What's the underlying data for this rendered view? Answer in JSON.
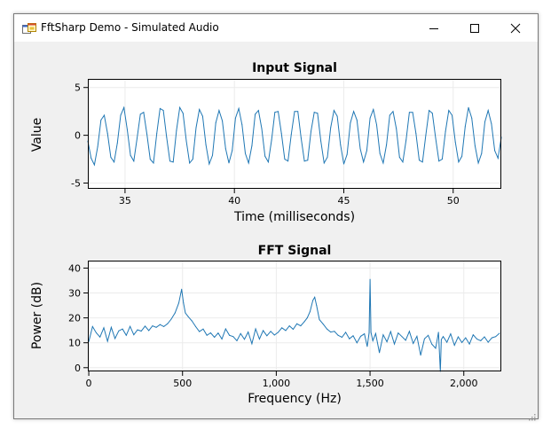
{
  "window": {
    "title": "FftSharp Demo - Simulated Audio",
    "icons": {
      "app": "app-icon",
      "minimize": "minimize-icon",
      "maximize": "maximize-icon",
      "close": "close-icon",
      "grip": "resize-grip-icon"
    }
  },
  "colors": {
    "series": "#1f77b4",
    "background": "#f0f0f0",
    "plot_bg": "#ffffff",
    "grid": "#ebebeb"
  },
  "chart_data": [
    {
      "type": "line",
      "title": "Input Signal",
      "xlabel": "Time (milliseconds)",
      "ylabel": "Value",
      "xlim": [
        33.3,
        52.2
      ],
      "ylim": [
        -5.6,
        5.9
      ],
      "xticks": [
        {
          "v": 35,
          "label": "35"
        },
        {
          "v": 40,
          "label": "40"
        },
        {
          "v": 45,
          "label": "45"
        },
        {
          "v": 50,
          "label": "50"
        }
      ],
      "yticks": [
        {
          "v": -5,
          "label": "-5"
        },
        {
          "v": 0,
          "label": "0"
        },
        {
          "v": 5,
          "label": "5"
        }
      ],
      "grid": true,
      "series": [
        {
          "x": [
            33.3,
            33.45,
            33.6,
            33.75,
            33.9,
            34.05,
            34.2,
            34.35,
            34.5,
            34.65,
            34.8,
            34.95,
            35.1,
            35.25,
            35.4,
            35.55,
            35.7,
            35.85,
            36,
            36.15,
            36.3,
            36.45,
            36.6,
            36.75,
            36.9,
            37.05,
            37.2,
            37.35,
            37.5,
            37.65,
            37.8,
            37.95,
            38.1,
            38.25,
            38.4,
            38.55,
            38.7,
            38.85,
            39,
            39.15,
            39.3,
            39.45,
            39.6,
            39.75,
            39.9,
            40.05,
            40.2,
            40.35,
            40.5,
            40.65,
            40.8,
            40.95,
            41.1,
            41.25,
            41.4,
            41.55,
            41.7,
            41.85,
            42,
            42.15,
            42.3,
            42.45,
            42.6,
            42.75,
            42.9,
            43.05,
            43.2,
            43.35,
            43.5,
            43.65,
            43.8,
            43.95,
            44.1,
            44.25,
            44.4,
            44.55,
            44.7,
            44.85,
            45,
            45.15,
            45.3,
            45.45,
            45.6,
            45.75,
            45.9,
            46.05,
            46.2,
            46.35,
            46.5,
            46.65,
            46.8,
            46.95,
            47.1,
            47.25,
            47.4,
            47.55,
            47.7,
            47.85,
            48,
            48.15,
            48.3,
            48.45,
            48.6,
            48.75,
            48.9,
            49.05,
            49.2,
            49.35,
            49.5,
            49.65,
            49.8,
            49.95,
            50.1,
            50.25,
            50.4,
            50.55,
            50.7,
            50.85,
            51,
            51.15,
            51.3,
            51.45,
            51.6,
            51.75,
            51.9,
            52.05,
            52.2
          ],
          "values": [
            -0.6,
            -2.4,
            -3.1,
            -1.2,
            1.6,
            2.1,
            0.2,
            -2.3,
            -2.8,
            -0.8,
            2.1,
            2.9,
            0.6,
            -2.1,
            -2.7,
            -0.3,
            2.2,
            2.4,
            0.1,
            -2.5,
            -2.9,
            0.2,
            2.8,
            2.6,
            -0.2,
            -2.7,
            -2.8,
            0.5,
            2.9,
            2.3,
            -0.6,
            -2.9,
            -2.5,
            0.8,
            2.7,
            2.0,
            -1.0,
            -3.0,
            -2.1,
            1.3,
            2.6,
            1.5,
            -1.4,
            -2.9,
            -1.6,
            1.8,
            2.8,
            1.1,
            -1.9,
            -2.9,
            -1.1,
            2.2,
            2.6,
            0.7,
            -2.2,
            -2.8,
            -0.5,
            2.4,
            2.5,
            0.2,
            -2.5,
            -2.7,
            0.1,
            2.5,
            2.5,
            -0.3,
            -2.7,
            -2.6,
            0.4,
            2.4,
            2.3,
            -0.6,
            -2.9,
            -2.3,
            0.8,
            2.6,
            2.0,
            -1.0,
            -3.0,
            -2.0,
            1.3,
            2.5,
            1.6,
            -1.4,
            -2.8,
            -1.6,
            1.8,
            2.7,
            1.1,
            -1.9,
            -2.9,
            -1.0,
            2.1,
            2.5,
            0.7,
            -2.3,
            -2.8,
            -0.5,
            2.4,
            2.4,
            0.2,
            -2.6,
            -2.8,
            0.0,
            2.6,
            2.3,
            -0.3,
            -2.7,
            -2.5,
            0.4,
            2.6,
            2.1,
            -0.7,
            -2.8,
            -2.2,
            0.9,
            2.9,
            1.8,
            -1.1,
            -2.9,
            -1.9,
            1.4,
            2.6,
            1.2,
            -1.6,
            -2.4,
            -0.2
          ]
        }
      ]
    },
    {
      "type": "line",
      "title": "FFT Signal",
      "xlabel": "Frequency (Hz)",
      "ylabel": "Power (dB)",
      "xlim": [
        -5,
        2200
      ],
      "ylim": [
        -1.5,
        43
      ],
      "xticks": [
        {
          "v": 0,
          "label": "0"
        },
        {
          "v": 500,
          "label": "500"
        },
        {
          "v": 1000,
          "label": "1,000"
        },
        {
          "v": 1500,
          "label": "1,500"
        },
        {
          "v": 2000,
          "label": "2,000"
        }
      ],
      "yticks": [
        {
          "v": 0,
          "label": "0"
        },
        {
          "v": 10,
          "label": "10"
        },
        {
          "v": 20,
          "label": "20"
        },
        {
          "v": 30,
          "label": "30"
        },
        {
          "v": 40,
          "label": "40"
        }
      ],
      "grid": true,
      "series": [
        {
          "x": [
            0,
            20,
            40,
            60,
            80,
            100,
            120,
            140,
            160,
            180,
            200,
            220,
            240,
            260,
            280,
            300,
            320,
            340,
            360,
            380,
            400,
            420,
            440,
            460,
            480,
            495,
            505,
            515,
            530,
            550,
            570,
            590,
            610,
            630,
            650,
            670,
            690,
            710,
            730,
            750,
            770,
            790,
            810,
            830,
            850,
            870,
            890,
            910,
            930,
            950,
            970,
            990,
            1010,
            1030,
            1050,
            1070,
            1090,
            1110,
            1130,
            1150,
            1165,
            1180,
            1195,
            1205,
            1215,
            1230,
            1250,
            1270,
            1290,
            1310,
            1330,
            1350,
            1370,
            1390,
            1410,
            1430,
            1450,
            1470,
            1485,
            1495,
            1500,
            1505,
            1515,
            1530,
            1550,
            1570,
            1590,
            1610,
            1630,
            1650,
            1670,
            1690,
            1710,
            1730,
            1750,
            1770,
            1790,
            1810,
            1830,
            1850,
            1865,
            1875,
            1880,
            1890,
            1910,
            1930,
            1950,
            1970,
            1990,
            2010,
            2030,
            2050,
            2070,
            2090,
            2110,
            2130,
            2150,
            2170,
            2190
          ],
          "values": [
            10.5,
            16.5,
            14,
            12.3,
            16,
            10.6,
            16.2,
            11.7,
            14.8,
            15.5,
            13,
            16.6,
            13.2,
            15.2,
            14.7,
            16.7,
            14.9,
            16.8,
            16.2,
            17.3,
            16.5,
            17.6,
            19.5,
            22,
            26,
            31.5,
            26,
            22,
            20.5,
            18.8,
            16.5,
            14.5,
            15.5,
            13,
            14,
            12.2,
            13.9,
            11.5,
            15.6,
            13,
            12.5,
            10.8,
            13.7,
            11.4,
            14.3,
            9.6,
            15.6,
            11.5,
            14.9,
            12.8,
            14.6,
            13.1,
            14.2,
            16,
            14.9,
            16.8,
            15.4,
            17.6,
            16.8,
            18.5,
            20,
            22.5,
            27,
            28.3,
            25,
            19.3,
            17.5,
            15.5,
            14.3,
            14.6,
            13,
            12.2,
            14.2,
            11.6,
            12.8,
            10,
            12.6,
            13.6,
            8.5,
            14,
            35.5,
            14.2,
            10.8,
            13.7,
            6,
            13.2,
            10.4,
            14.5,
            9.5,
            13.9,
            12.5,
            11,
            14.6,
            9.7,
            12.6,
            5,
            11.6,
            13,
            9.4,
            7.8,
            14.2,
            -1.5,
            11.3,
            12.5,
            10.2,
            13.6,
            9,
            12.4,
            10.1,
            12,
            9.5,
            13.2,
            11.5,
            10.8,
            12.4,
            10.2,
            12,
            12.5,
            13.8
          ]
        }
      ]
    }
  ]
}
